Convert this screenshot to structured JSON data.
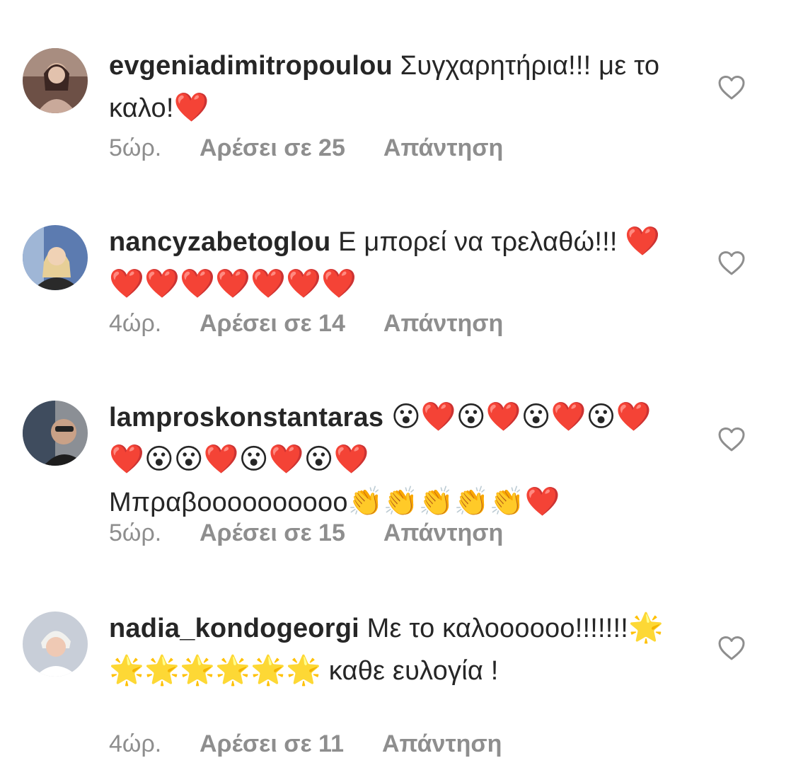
{
  "comments": [
    {
      "username": "evgeniadimitropoulou",
      "text": " Συγχαρητήρια!!! με το καλο!",
      "emoji": "❤️",
      "time": "5ώρ.",
      "likes": "Αρέσει σε 25",
      "reply": "Απάντηση"
    },
    {
      "username": "nancyzabetoglou",
      "text": " Ε μπορεί να τρελαθώ!!! ",
      "emoji": "❤️❤️❤️❤️❤️❤️❤️❤️",
      "time": "4ώρ.",
      "likes": "Αρέσει σε 14",
      "reply": "Απάντηση"
    },
    {
      "username": "lamproskonstantaras",
      "text": " ",
      "emoji": "😮❤️😮❤️😮❤️😮❤️❤️😮😮❤️😮❤️😮❤️",
      "text2": "Μπραβοοοοοοοοοο",
      "emoji2": "👏👏👏👏👏❤️",
      "time": "5ώρ.",
      "likes": "Αρέσει σε 15",
      "reply": "Απάντηση"
    },
    {
      "username": "nadia_kondogeorgi",
      "text": " Με το καλοοοοοο!!!!!!!",
      "emoji": "🌟🌟🌟🌟🌟🌟🌟",
      "text2": " καθε ευλογία !",
      "time": "4ώρ.",
      "likes": "Αρέσει σε 11",
      "reply": "Απάντηση"
    }
  ],
  "colors": {
    "text": "#262626",
    "meta": "#8e8e8e",
    "heart_outline": "#8e8e8e"
  },
  "icons": {
    "like": "heart-outline-icon"
  }
}
